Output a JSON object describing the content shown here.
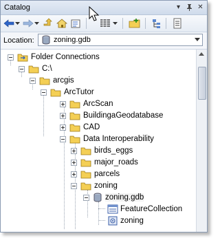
{
  "window": {
    "title": "Catalog"
  },
  "location": {
    "label": "Location:",
    "value": "zoning.gdb"
  },
  "toolbar": {
    "icons": [
      "back-arrow-icon",
      "forward-arrow-icon",
      "up-one-level-icon",
      "home-icon",
      "toggle-contents-icon",
      "view-options-icon",
      "connect-folder-icon",
      "tree-options-icon",
      "properties-icon"
    ]
  },
  "tree": [
    {
      "label": "Folder Connections",
      "icon": "folder-connections-icon",
      "expanded": true
    },
    {
      "label": "C:\\",
      "icon": "folder-icon",
      "expanded": true
    },
    {
      "label": "arcgis",
      "icon": "folder-icon",
      "expanded": true
    },
    {
      "label": "ArcTutor",
      "icon": "folder-icon",
      "expanded": true
    },
    {
      "label": "ArcScan",
      "icon": "folder-icon",
      "expanded": false
    },
    {
      "label": "BuildingaGeodatabase",
      "icon": "folder-icon",
      "expanded": false
    },
    {
      "label": "CAD",
      "icon": "folder-icon",
      "expanded": false
    },
    {
      "label": "Data Interoperability",
      "icon": "folder-icon",
      "expanded": true
    },
    {
      "label": "birds_eggs",
      "icon": "folder-icon",
      "expanded": false
    },
    {
      "label": "major_roads",
      "icon": "folder-icon",
      "expanded": false
    },
    {
      "label": "parcels",
      "icon": "folder-icon",
      "expanded": false
    },
    {
      "label": "zoning",
      "icon": "folder-icon",
      "expanded": true
    },
    {
      "label": "zoning.gdb",
      "icon": "geodatabase-icon",
      "expanded": true,
      "selected": true
    },
    {
      "label": "FeatureCollection",
      "icon": "feature-class-icon"
    },
    {
      "label": "zoning",
      "icon": "table-icon"
    }
  ]
}
